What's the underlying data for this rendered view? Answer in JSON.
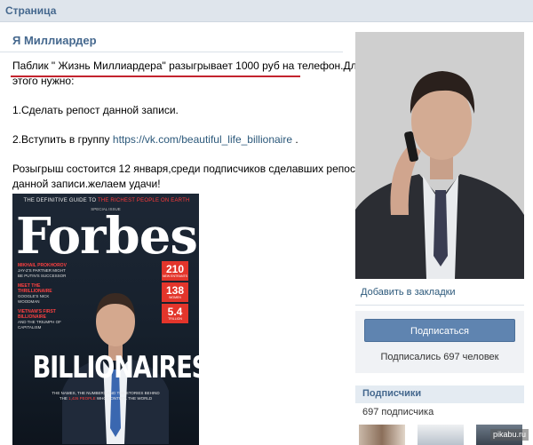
{
  "top_bar": {
    "title": "Страница"
  },
  "page": {
    "title": "Я Миллиардер"
  },
  "post": {
    "line1": "Паблик \" Жизнь Миллиардера\" разыгрывает 1000 руб на телефон.Для",
    "line2": "этого нужно:",
    "item1": "1.Сделать репост данной записи.",
    "item2_prefix": "2.Вступить в группу ",
    "item2_link": "https://vk.com/beautiful_life_billionaire",
    "item2_suffix": " .",
    "raffle_line1": "Розыгрыш состоится 12 января,среди подписчиков сделавших репост",
    "raffle_line2": "данной записи.желаем удачи!"
  },
  "cover": {
    "tagline_white": "THE DEFINITIVE GUIDE TO ",
    "tagline_red": "THE RICHEST PEOPLE ON EARTH",
    "special": "SPECIAL ISSUE",
    "logo": "Forbes",
    "sidebar": [
      {
        "head": "MIKHAIL PROKHOROV",
        "text": "JAY-Z'S PARTNER MIGHT BE PUTIN'S SUCCESSOR"
      },
      {
        "head": "MEET THE THRILLIONAIRE",
        "text": "GOOGLE'S NICK WOODMAN"
      },
      {
        "head": "VIETNAM'S FIRST BILLIONAIRE",
        "text": "AND THE TRIUMPH OF CAPITALISM"
      }
    ],
    "badges": [
      {
        "value": "210",
        "label": "NEW ENTRANTS"
      },
      {
        "value": "138",
        "label": "WOMEN"
      },
      {
        "value": "5.4",
        "label": "TRILLION"
      }
    ],
    "headline": "BILLIONAIRES",
    "footer_line1": "THE NAMES, THE NUMBERS AND THE STORIES BEHIND",
    "footer_line2_white": "THE ",
    "footer_line2_red": "1,426 PEOPLE",
    "footer_line2_end": " WHO CONTROL THE WORLD"
  },
  "sidebar": {
    "bookmark": "Добавить в закладки",
    "subscribe_button": "Подписаться",
    "subscribed_count": "Подписались 697 человек",
    "subscribers_header": "Подписчики",
    "subscribers_count": "697 подписчика"
  },
  "watermark": "pikabu.ru",
  "colors": {
    "accent": "#45688e",
    "link": "#2b587a",
    "button": "#5f84b0",
    "underline": "#c3232e"
  }
}
